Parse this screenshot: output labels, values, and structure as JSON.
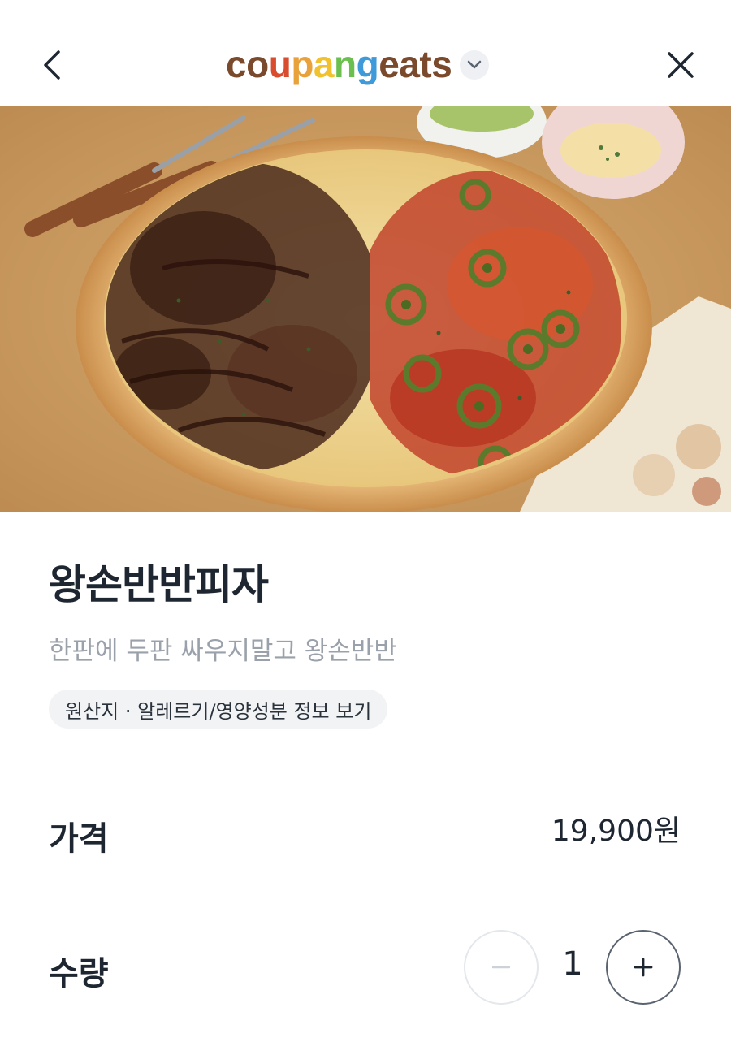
{
  "header": {
    "logo_parts": [
      {
        "text": "c",
        "color": "#7b4a2c"
      },
      {
        "text": "o",
        "color": "#7b4a2c"
      },
      {
        "text": "u",
        "color": "#d94d2e"
      },
      {
        "text": "p",
        "color": "#e9a23b"
      },
      {
        "text": "a",
        "color": "#f2c12e"
      },
      {
        "text": "n",
        "color": "#6bbf4e"
      },
      {
        "text": "g",
        "color": "#3e9ad8"
      },
      {
        "text": " eats",
        "color": "#7b4a2c"
      }
    ],
    "back_icon": "chevron-left-icon",
    "close_icon": "close-icon",
    "dropdown_icon": "chevron-down-icon"
  },
  "hero": {
    "description_icon": "pizza-photo"
  },
  "product": {
    "title": "왕손반반피자",
    "subtitle": "한판에 두판 싸우지말고 왕손반반",
    "info_link": "원산지 · 알레르기/영양성분 정보 보기"
  },
  "price": {
    "label": "가격",
    "value": "19,900원"
  },
  "quantity": {
    "label": "수량",
    "value": "1",
    "minus_symbol": "−",
    "plus_symbol": "+"
  }
}
